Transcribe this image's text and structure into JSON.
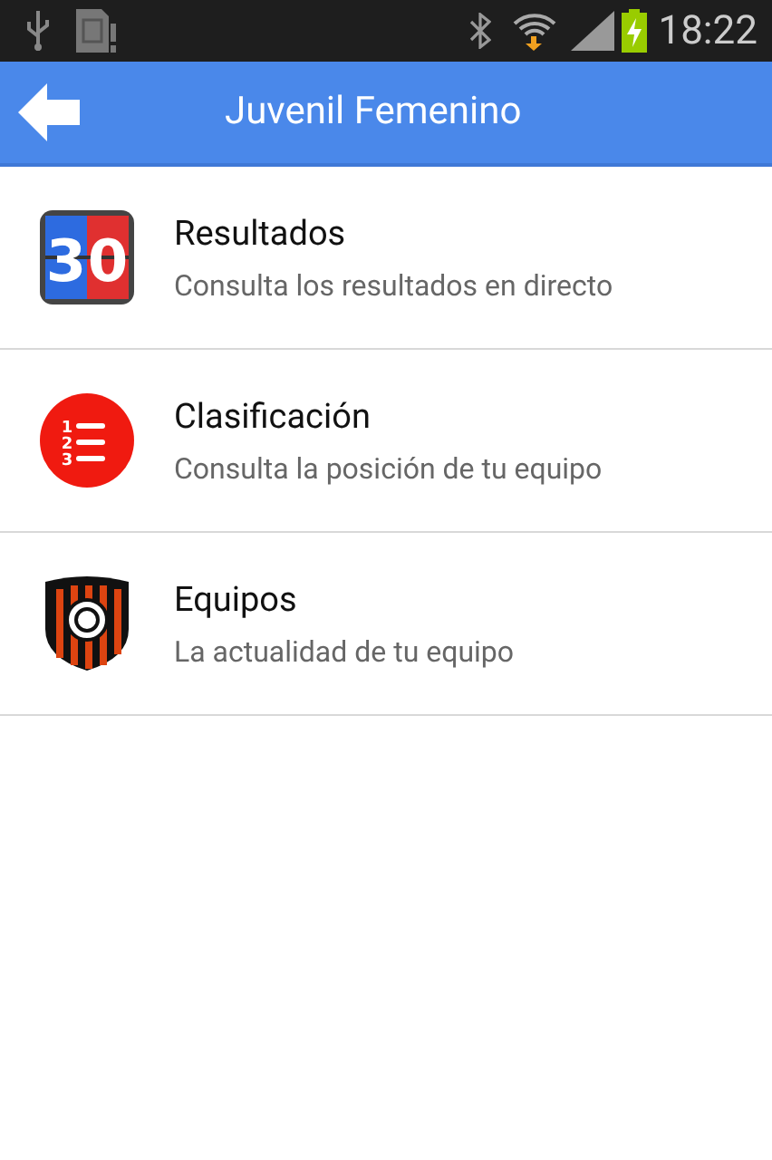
{
  "status_bar": {
    "time": "18:22"
  },
  "app_bar": {
    "title": "Juvenil Femenino"
  },
  "menu": [
    {
      "kind": "scoreboard",
      "icon_text": "30",
      "title": "Resultados",
      "subtitle": "Consulta los resultados en directo"
    },
    {
      "kind": "ranking",
      "icon_numbers": [
        "1",
        "2",
        "3"
      ],
      "title": "Clasificación",
      "subtitle": "Consulta la posición de tu equipo"
    },
    {
      "kind": "crest",
      "title": "Equipos",
      "subtitle": "La actualidad de tu equipo"
    }
  ]
}
